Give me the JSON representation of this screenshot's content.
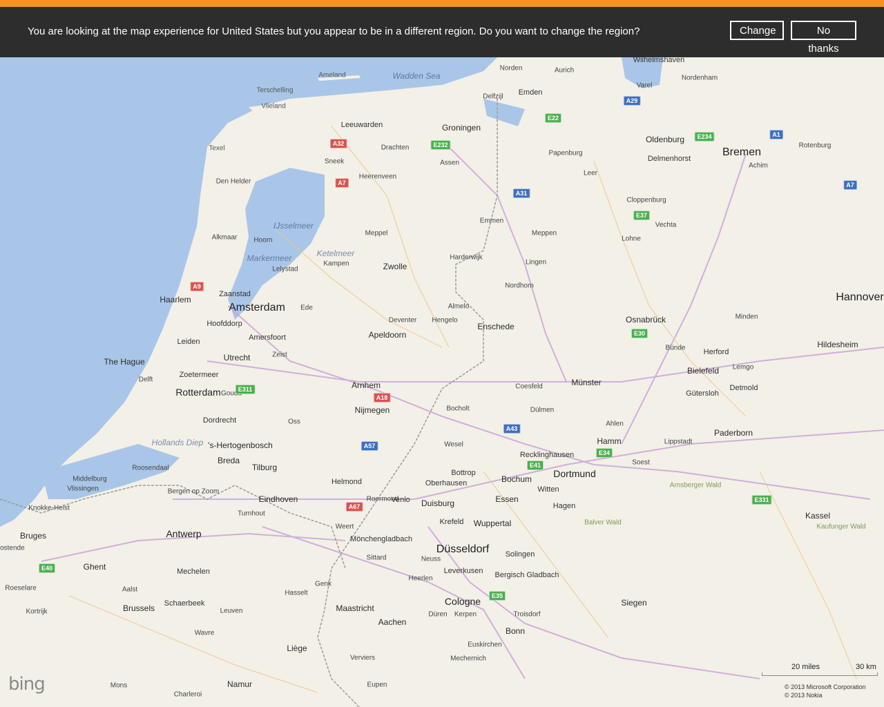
{
  "banner": {
    "message": "You are looking at the map experience for United States but you appear to be in a different region. Do you want to change the region?",
    "change_label": "Change",
    "no_thanks_label": "No thanks",
    "accent_color": "#f7941d",
    "background_color": "#2d2d2d"
  },
  "map": {
    "water_color": "#a9c6e8",
    "land_color": "#f3f0e8",
    "provider_logo": "bing",
    "scale": {
      "miles": "20 miles",
      "km": "30 km"
    },
    "copyright": [
      "© 2013 Microsoft Corporation",
      "© 2013 Nokia"
    ],
    "labels": [
      {
        "text": "Amsterdam",
        "cls": "c1"
      },
      {
        "text": "Bremen",
        "cls": "c1"
      },
      {
        "text": "Düsseldorf",
        "cls": "c1"
      },
      {
        "text": "Hannover",
        "cls": "c1"
      },
      {
        "text": "Rotterdam",
        "cls": "c2"
      },
      {
        "text": "Cologne",
        "cls": "c2"
      },
      {
        "text": "Dortmund",
        "cls": "c2"
      },
      {
        "text": "Antwerp",
        "cls": "c2"
      },
      {
        "text": "Groningen",
        "cls": "c3"
      },
      {
        "text": "Oldenburg",
        "cls": "c3"
      },
      {
        "text": "Zwolle",
        "cls": "c3"
      },
      {
        "text": "The Hague",
        "cls": "c3"
      },
      {
        "text": "Utrecht",
        "cls": "c3"
      },
      {
        "text": "Haarlem",
        "cls": "c3"
      },
      {
        "text": "Arnhem",
        "cls": "c3"
      },
      {
        "text": "Nijmegen",
        "cls": "c3"
      },
      {
        "text": "Duisburg",
        "cls": "c3"
      },
      {
        "text": "Essen",
        "cls": "c3"
      },
      {
        "text": "Bochum",
        "cls": "c3"
      },
      {
        "text": "Münster",
        "cls": "c3"
      },
      {
        "text": "Osnabrück",
        "cls": "c3"
      },
      {
        "text": "Bielefeld",
        "cls": "c3"
      },
      {
        "text": "Hildesheim",
        "cls": "c3"
      },
      {
        "text": "Brussels",
        "cls": "c3"
      },
      {
        "text": "Ghent",
        "cls": "c3"
      },
      {
        "text": "Bruges",
        "cls": "c3"
      },
      {
        "text": "Liège",
        "cls": "c3"
      },
      {
        "text": "Maastricht",
        "cls": "c3"
      },
      {
        "text": "Aachen",
        "cls": "c3"
      },
      {
        "text": "Eindhoven",
        "cls": "c3"
      },
      {
        "text": "Tilburg",
        "cls": "c3"
      },
      {
        "text": "Breda",
        "cls": "c3"
      },
      {
        "text": "'s-Hertogenbosch",
        "cls": "c3"
      },
      {
        "text": "Apeldoorn",
        "cls": "c3"
      },
      {
        "text": "Enschede",
        "cls": "c3"
      },
      {
        "text": "Hamm",
        "cls": "c3"
      },
      {
        "text": "Wuppertal",
        "cls": "c3"
      },
      {
        "text": "Bonn",
        "cls": "c3"
      },
      {
        "text": "Siegen",
        "cls": "c3"
      },
      {
        "text": "Kassel",
        "cls": "c3"
      },
      {
        "text": "Paderborn",
        "cls": "c3"
      },
      {
        "text": "Namur",
        "cls": "c3"
      },
      {
        "text": "Leeuwarden",
        "cls": "c4"
      },
      {
        "text": "Emden",
        "cls": "c4"
      },
      {
        "text": "Wilhelmshaven",
        "cls": "c4"
      },
      {
        "text": "Delmenhorst",
        "cls": "c4"
      },
      {
        "text": "Leiden",
        "cls": "c4"
      },
      {
        "text": "Zaanstad",
        "cls": "c4"
      },
      {
        "text": "Hoofddorp",
        "cls": "c4"
      },
      {
        "text": "Amersfoort",
        "cls": "c4"
      },
      {
        "text": "Dordrecht",
        "cls": "c4"
      },
      {
        "text": "Zoetermeer",
        "cls": "c4"
      },
      {
        "text": "Mönchengladbach",
        "cls": "c4"
      },
      {
        "text": "Krefeld",
        "cls": "c4"
      },
      {
        "text": "Oberhausen",
        "cls": "c4"
      },
      {
        "text": "Bottrop",
        "cls": "c4"
      },
      {
        "text": "Recklinghausen",
        "cls": "c4"
      },
      {
        "text": "Witten",
        "cls": "c4"
      },
      {
        "text": "Hagen",
        "cls": "c4"
      },
      {
        "text": "Solingen",
        "cls": "c4"
      },
      {
        "text": "Leverkusen",
        "cls": "c4"
      },
      {
        "text": "Bergisch Gladbach",
        "cls": "c4"
      },
      {
        "text": "Herford",
        "cls": "c4"
      },
      {
        "text": "Detmold",
        "cls": "c4"
      },
      {
        "text": "Gütersloh",
        "cls": "c4"
      },
      {
        "text": "Mechelen",
        "cls": "c4"
      },
      {
        "text": "Schaerbeek",
        "cls": "c4"
      },
      {
        "text": "Helmond",
        "cls": "c4"
      },
      {
        "text": "Venlo",
        "cls": "c4"
      },
      {
        "text": "Achim",
        "cls": "c5"
      },
      {
        "text": "Rotenburg",
        "cls": "c5"
      },
      {
        "text": "Papenburg",
        "cls": "c5"
      },
      {
        "text": "Meppen",
        "cls": "c5"
      },
      {
        "text": "Lingen",
        "cls": "c5"
      },
      {
        "text": "Nordhorn",
        "cls": "c5"
      },
      {
        "text": "Hengelo",
        "cls": "c5"
      },
      {
        "text": "Almelo",
        "cls": "c5"
      },
      {
        "text": "Deventer",
        "cls": "c5"
      },
      {
        "text": "Assen",
        "cls": "c5"
      },
      {
        "text": "Emmen",
        "cls": "c5"
      },
      {
        "text": "Drachten",
        "cls": "c5"
      },
      {
        "text": "Sneek",
        "cls": "c5"
      },
      {
        "text": "Heerenveen",
        "cls": "c5"
      },
      {
        "text": "Meppel",
        "cls": "c5"
      },
      {
        "text": "Kampen",
        "cls": "c5"
      },
      {
        "text": "Lelystad",
        "cls": "c5"
      },
      {
        "text": "Alkmaar",
        "cls": "c5"
      },
      {
        "text": "Hoorn",
        "cls": "c5"
      },
      {
        "text": "Den Helder",
        "cls": "c5"
      },
      {
        "text": "Delft",
        "cls": "c5"
      },
      {
        "text": "Gouda",
        "cls": "c5"
      },
      {
        "text": "Vechta",
        "cls": "c5"
      },
      {
        "text": "Cloppenburg",
        "cls": "c5"
      },
      {
        "text": "Lohne",
        "cls": "c5"
      },
      {
        "text": "Minden",
        "cls": "c5"
      },
      {
        "text": "Bünde",
        "cls": "c5"
      },
      {
        "text": "Lemgo",
        "cls": "c5"
      },
      {
        "text": "Lippstadt",
        "cls": "c5"
      },
      {
        "text": "Soest",
        "cls": "c5"
      },
      {
        "text": "Ahlen",
        "cls": "c5"
      },
      {
        "text": "Dülmen",
        "cls": "c5"
      },
      {
        "text": "Coesfeld",
        "cls": "c5"
      },
      {
        "text": "Bocholt",
        "cls": "c5"
      },
      {
        "text": "Wesel",
        "cls": "c5"
      },
      {
        "text": "Neuss",
        "cls": "c5"
      },
      {
        "text": "Düren",
        "cls": "c5"
      },
      {
        "text": "Kerpen",
        "cls": "c5"
      },
      {
        "text": "Troisdorf",
        "cls": "c5"
      },
      {
        "text": "Mechernich",
        "cls": "c5"
      },
      {
        "text": "Euskirchen",
        "cls": "c5"
      },
      {
        "text": "Aalst",
        "cls": "c5"
      },
      {
        "text": "Leuven",
        "cls": "c5"
      },
      {
        "text": "Hasselt",
        "cls": "c5"
      },
      {
        "text": "Genk",
        "cls": "c5"
      },
      {
        "text": "Turnhout",
        "cls": "c5"
      },
      {
        "text": "Roosendaal",
        "cls": "c5"
      },
      {
        "text": "Bergen op Zoom",
        "cls": "c5"
      },
      {
        "text": "Middelburg",
        "cls": "c5"
      },
      {
        "text": "Vlissingen",
        "cls": "c5"
      },
      {
        "text": "Knokke-Heist",
        "cls": "c5"
      },
      {
        "text": "Oostende",
        "cls": "c5"
      },
      {
        "text": "Kortrijk",
        "cls": "c5"
      },
      {
        "text": "Roeselare",
        "cls": "c5"
      },
      {
        "text": "Charleroi",
        "cls": "c5"
      },
      {
        "text": "Mons",
        "cls": "c5"
      },
      {
        "text": "Wavre",
        "cls": "c5"
      },
      {
        "text": "Verviers",
        "cls": "c5"
      },
      {
        "text": "Eupen",
        "cls": "c5"
      },
      {
        "text": "Nordenham",
        "cls": "c5"
      },
      {
        "text": "Varel",
        "cls": "c5"
      },
      {
        "text": "Aurich",
        "cls": "c5"
      },
      {
        "text": "Norden",
        "cls": "c5"
      },
      {
        "text": "Leer",
        "cls": "c5"
      },
      {
        "text": "Delfzijl",
        "cls": "c5"
      },
      {
        "text": "Weert",
        "cls": "c5"
      },
      {
        "text": "Sittard",
        "cls": "c5"
      },
      {
        "text": "Heerlen",
        "cls": "c5"
      },
      {
        "text": "Roermond",
        "cls": "c5"
      },
      {
        "text": "Oss",
        "cls": "c5"
      },
      {
        "text": "Ede",
        "cls": "c5"
      },
      {
        "text": "Zeist",
        "cls": "c5"
      },
      {
        "text": "Harderwijk",
        "cls": "c5"
      },
      {
        "text": "Wadden Sea",
        "cls": "water-big"
      },
      {
        "text": "Markermeer",
        "cls": "water-big"
      },
      {
        "text": "IJsselmeer",
        "cls": "water-big"
      },
      {
        "text": "Ketelmeer",
        "cls": "water"
      },
      {
        "text": "Terschelling",
        "cls": "minor"
      },
      {
        "text": "Texel",
        "cls": "minor"
      },
      {
        "text": "Vlieland",
        "cls": "minor"
      },
      {
        "text": "Ameland",
        "cls": "minor"
      },
      {
        "text": "Hollands Diep",
        "cls": "water"
      },
      {
        "text": "Balver Wald",
        "cls": "green"
      },
      {
        "text": "Arnsberger Wald",
        "cls": "green"
      },
      {
        "text": "Kaufunger Wald",
        "cls": "green"
      }
    ]
  }
}
